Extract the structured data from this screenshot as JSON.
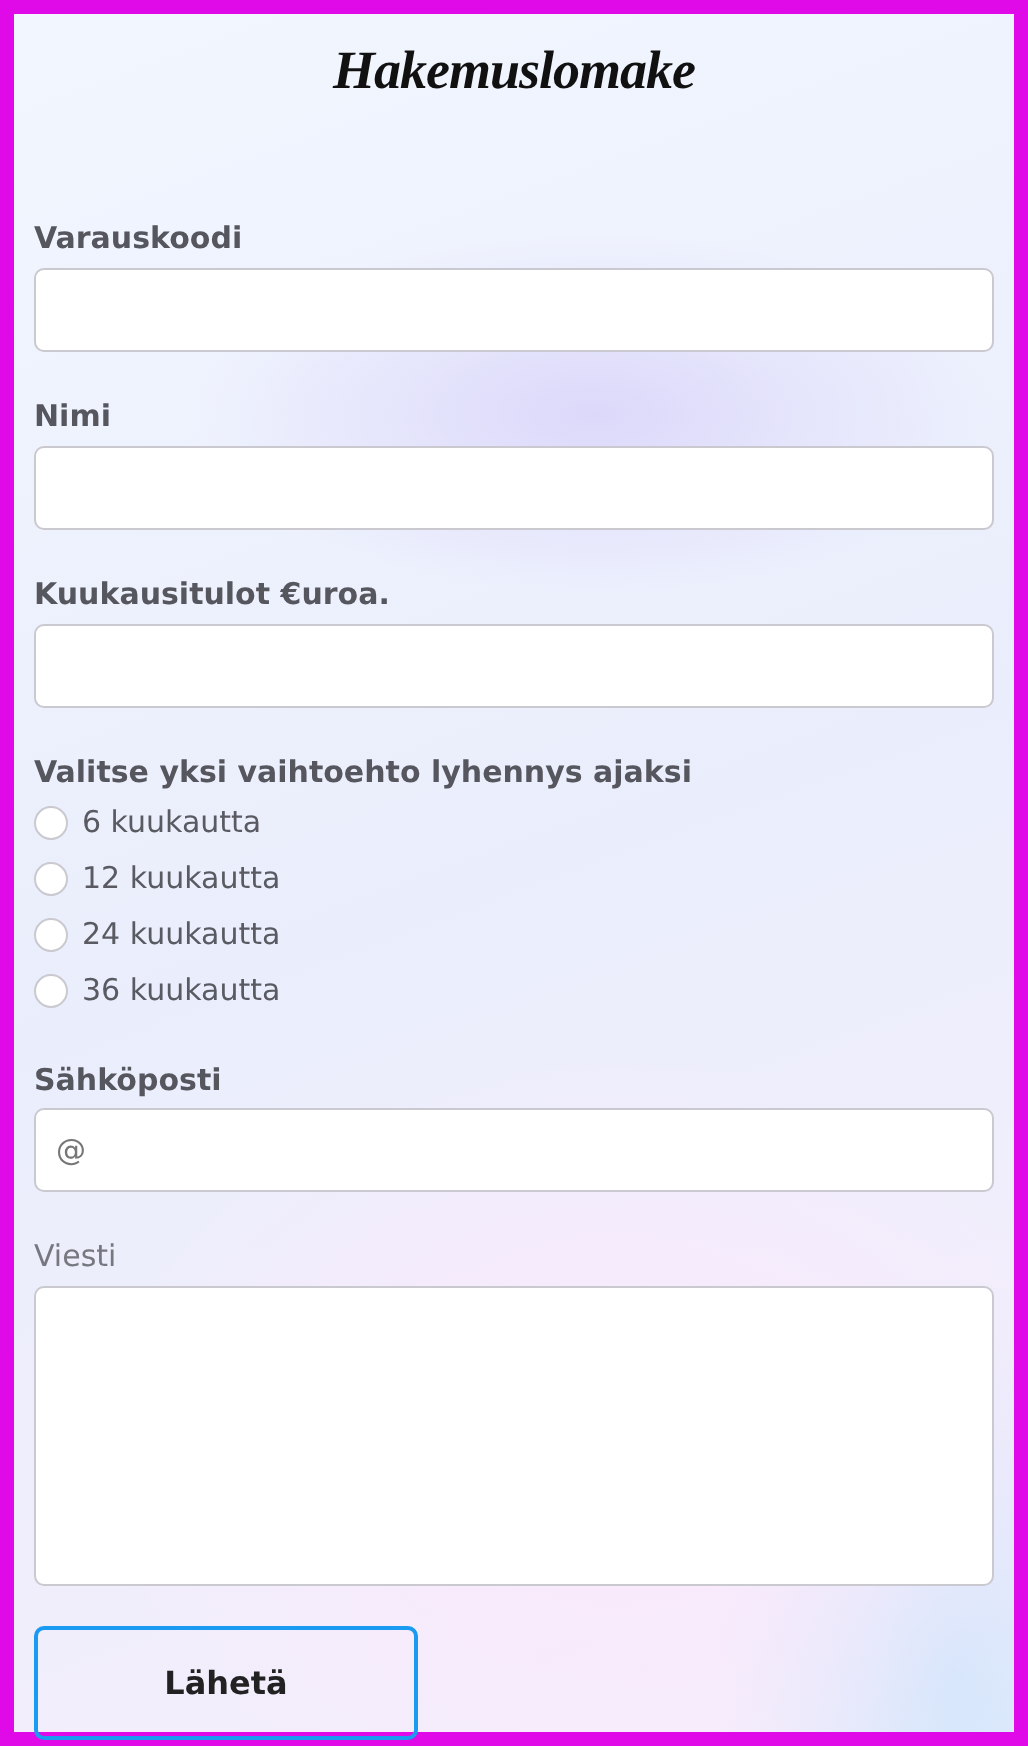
{
  "title": "Hakemuslomake",
  "sections": [
    {
      "kind": "text",
      "label": "Varauskoodi"
    },
    {
      "kind": "text",
      "label": "Nimi"
    },
    {
      "kind": "text",
      "label": "Kuukausitulot €uroa."
    },
    {
      "kind": "radio",
      "label": "Valitse yksi vaihtoehto lyhennys ajaksi",
      "options": [
        {
          "label": "6 kuukautta",
          "selected": false
        },
        {
          "label": "12 kuukautta",
          "selected": false
        },
        {
          "label": "24 kuukautta",
          "selected": false
        },
        {
          "label": "36 kuukautta",
          "selected": false
        }
      ]
    },
    {
      "kind": "email",
      "label": "Sähköposti",
      "placeholder": "@"
    },
    {
      "kind": "textarea",
      "label": "Viesti"
    }
  ],
  "submit": "Lähetä"
}
